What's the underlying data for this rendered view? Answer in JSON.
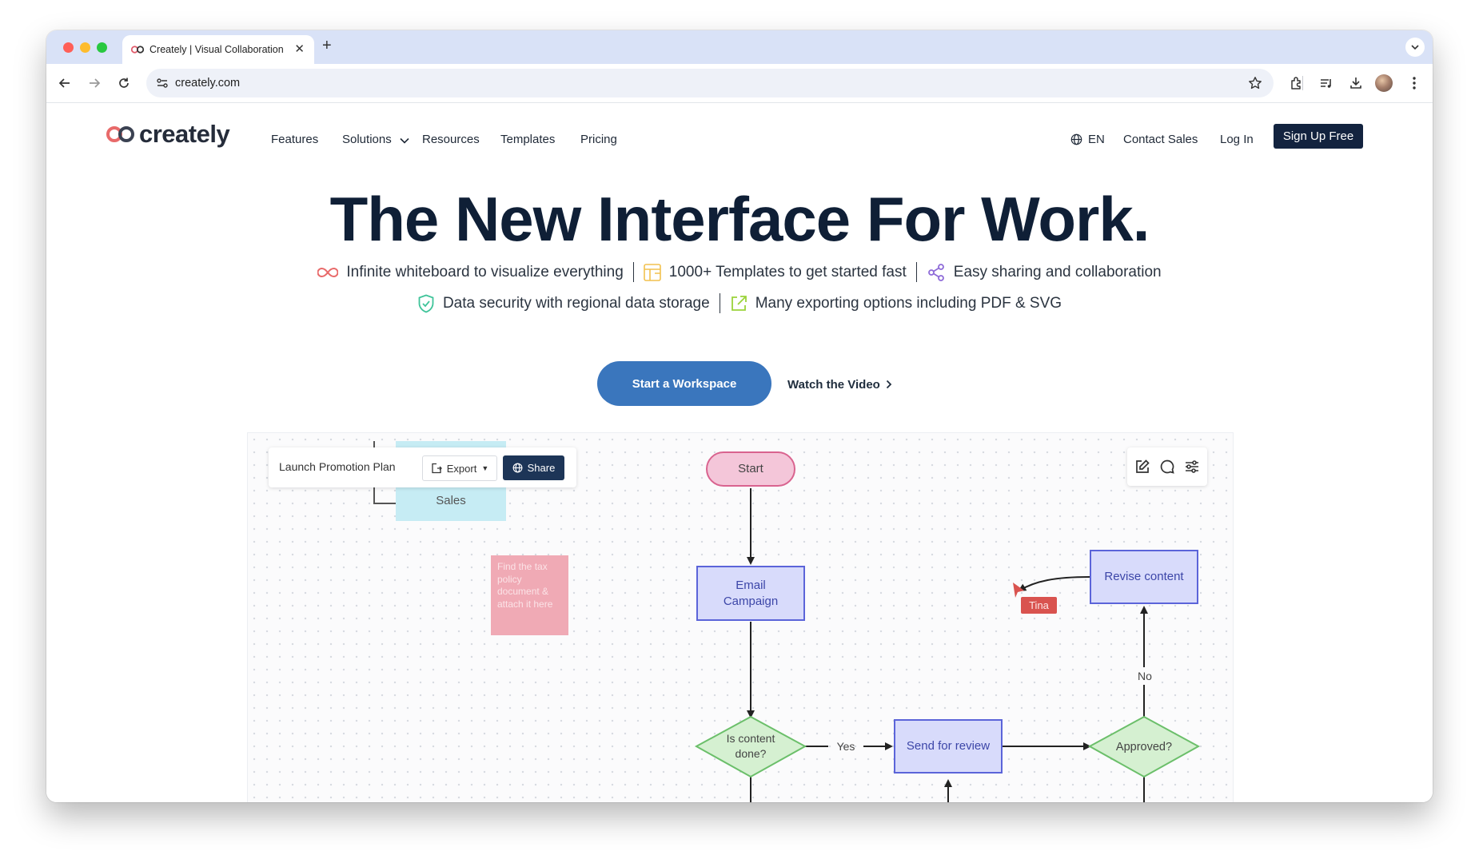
{
  "browser": {
    "tab_title": "Creately | Visual Collaboration",
    "url": "creately.com",
    "icons": [
      "back-icon",
      "forward-icon",
      "reload-icon",
      "site-settings-icon",
      "star-icon",
      "extensions-icon",
      "reading-list-icon",
      "download-icon",
      "profile-avatar",
      "more-icon"
    ]
  },
  "site": {
    "logo_text": "creately",
    "nav": {
      "features": "Features",
      "solutions": "Solutions",
      "resources": "Resources",
      "templates": "Templates",
      "pricing": "Pricing",
      "language": "EN",
      "contact": "Contact Sales",
      "login": "Log In",
      "signup": "Sign Up Free"
    },
    "hero": {
      "title": "The New Interface For Work.",
      "features": [
        "Infinite whiteboard to visualize everything",
        "1000+ Templates to get started fast",
        "Easy sharing and collaboration",
        "Data security with regional data storage",
        "Many exporting options including PDF & SVG"
      ],
      "cta": "Start a Workspace",
      "watch": "Watch the Video"
    },
    "demo": {
      "plan_name": "Launch Promotion Plan",
      "export": "Export",
      "share": "Share",
      "sales_label": "Sales",
      "sticky_note": "Find the tax policy document & attach it here",
      "start": "Start",
      "email_campaign": "Email Campaign",
      "is_content_done": "Is content done?",
      "yes": "Yes",
      "send_for_review": "Send for review",
      "approved": "Approved?",
      "no": "No",
      "revise_content": "Revise content",
      "cursor_user": "Tina"
    }
  },
  "colors": {
    "brand_dark": "#13233f",
    "cta_blue": "#3a76bd",
    "hero_text": "#0f1f36",
    "node_purple_fill": "#d8dbfb",
    "node_purple_border": "#5b64d9",
    "start_fill": "#f4c6d9",
    "diamond_fill": "#d5f0d1",
    "diamond_border": "#6bbf6a",
    "tina_red": "#d9534f"
  }
}
